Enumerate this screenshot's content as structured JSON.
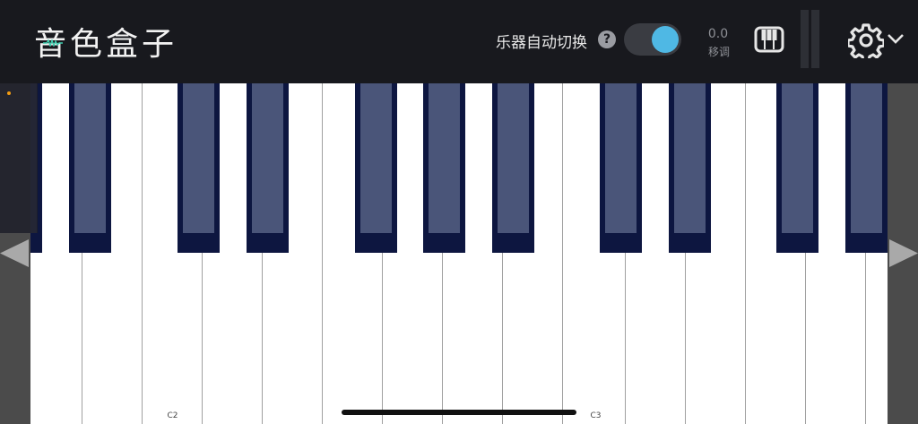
{
  "header": {
    "app_title": "音色盒子",
    "auto_switch_label": "乐器自动切换",
    "help_symbol": "?",
    "auto_switch_on": true,
    "transpose_value": "0.0",
    "transpose_label": "移调"
  },
  "colors": {
    "accent": "#4fb8e4",
    "topbar": "#18191e",
    "black_key": "#0d1640",
    "black_key_face": "#4a5579",
    "highlight_dot": "#f39c12"
  },
  "icons": [
    "keyboard-icon",
    "level-meter",
    "gear-icon",
    "chevron-down-icon",
    "left-arrow-icon",
    "right-arrow-icon"
  ],
  "keyboard": {
    "octave_labels": [
      {
        "key_index": 2,
        "label": "C2"
      },
      {
        "key_index": 9,
        "label": "C3"
      }
    ]
  }
}
